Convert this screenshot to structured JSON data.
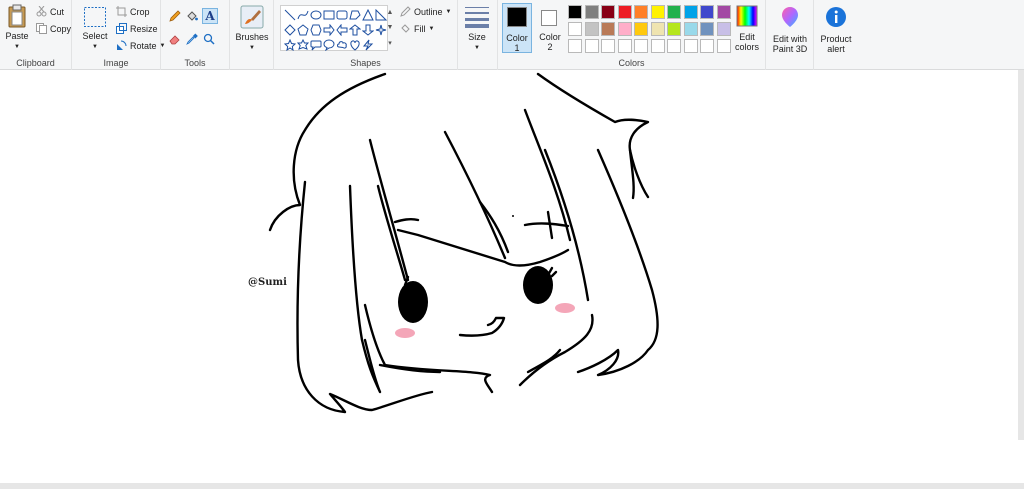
{
  "clipboard": {
    "paste": "Paste",
    "cut": "Cut",
    "copy": "Copy",
    "label": "Clipboard"
  },
  "image": {
    "select": "Select",
    "crop": "Crop",
    "resize": "Resize",
    "rotate": "Rotate",
    "label": "Image"
  },
  "tools": {
    "label": "Tools"
  },
  "brushes": {
    "label": "Brushes"
  },
  "shapes": {
    "outline": "Outline",
    "fill": "Fill",
    "label": "Shapes"
  },
  "size": {
    "label": "Size"
  },
  "colors": {
    "color1_line1": "Color",
    "color1_line2": "1",
    "color2_line1": "Color",
    "color2_line2": "2",
    "edit_line1": "Edit",
    "edit_line2": "colors",
    "label": "Colors",
    "color1_value": "#000000",
    "color2_value": "#ffffff",
    "palette_row1": [
      "#000000",
      "#7f7f7f",
      "#880015",
      "#ed1c24",
      "#ff7f27",
      "#fff200",
      "#22b14c",
      "#00a2e8",
      "#3f48cc",
      "#a349a4"
    ],
    "palette_row2": [
      "#ffffff",
      "#c3c3c3",
      "#b97a57",
      "#ffaec9",
      "#ffc90e",
      "#efe4b0",
      "#b5e61d",
      "#99d9ea",
      "#7092be",
      "#c8bfe7"
    ],
    "palette_row3": [
      "#ffffff",
      "#ffffff",
      "#ffffff",
      "#ffffff",
      "#ffffff",
      "#ffffff",
      "#ffffff",
      "#ffffff",
      "#ffffff",
      "#ffffff"
    ]
  },
  "paint3d": {
    "line1": "Edit with",
    "line2": "Paint 3D"
  },
  "product_alert": {
    "line1": "Product",
    "line2": "alert"
  },
  "canvas": {
    "watermark": "@Sumi"
  }
}
